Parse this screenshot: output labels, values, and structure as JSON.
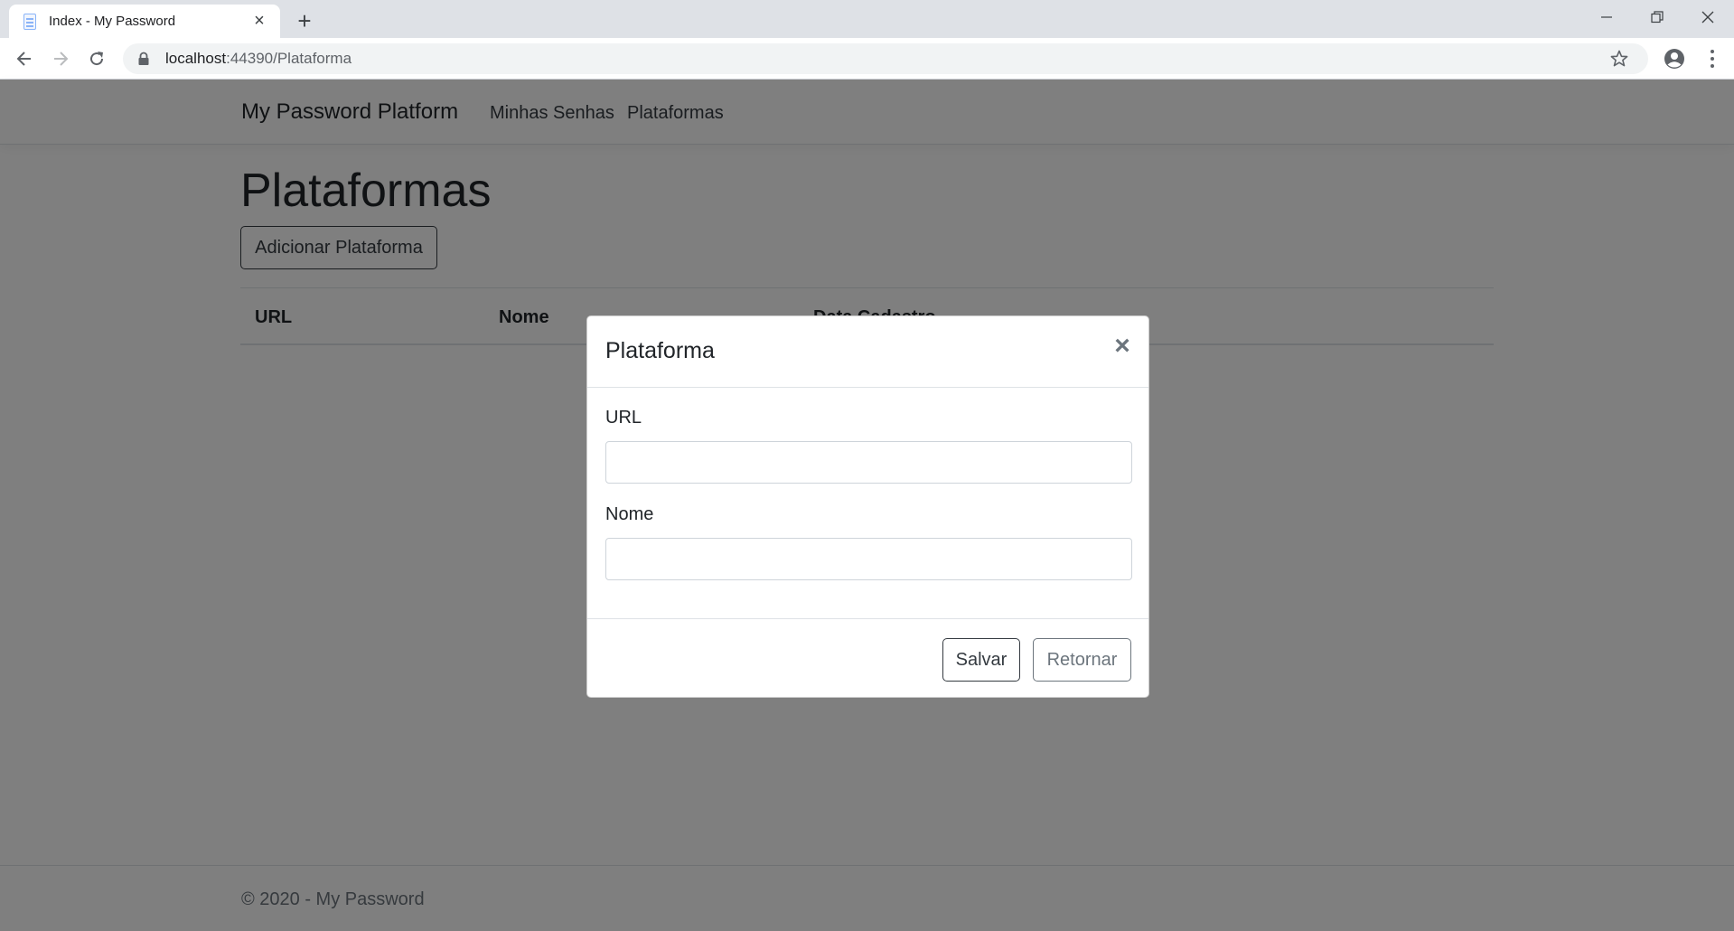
{
  "browser": {
    "tab_title": "Index - My Password",
    "url_host": "localhost",
    "url_rest": ":44390/Plataforma"
  },
  "site": {
    "brand": "My Password Platform",
    "nav": [
      "Minhas Senhas",
      "Plataformas"
    ]
  },
  "page": {
    "title": "Plataformas",
    "add_button": "Adicionar Plataforma",
    "table_headers": [
      "URL",
      "Nome",
      "Data Cadastro"
    ]
  },
  "footer": {
    "text": "© 2020 - My Password"
  },
  "modal": {
    "title": "Plataforma",
    "close_glyph": "×",
    "fields": [
      {
        "label": "URL",
        "value": ""
      },
      {
        "label": "Nome",
        "value": ""
      }
    ],
    "save_label": "Salvar",
    "return_label": "Retornar"
  }
}
